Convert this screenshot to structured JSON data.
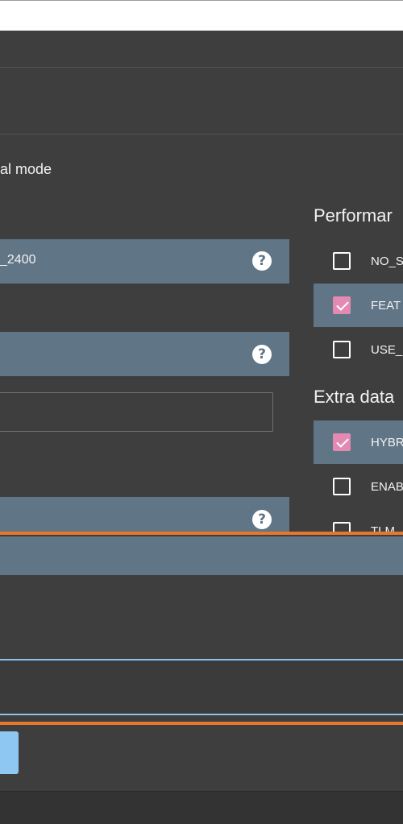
{
  "mode_text": "al mode",
  "fields": [
    {
      "value": "_2400",
      "help": "?"
    },
    {
      "value": "",
      "help": "?"
    },
    {
      "value": "",
      "help": "?"
    }
  ],
  "performance": {
    "title": "Performar",
    "items": [
      {
        "label": "NO_S",
        "checked": false
      },
      {
        "label": "FEAT",
        "checked": true
      },
      {
        "label": "USE_",
        "checked": false
      }
    ]
  },
  "extra_data": {
    "title": "Extra data",
    "items": [
      {
        "label": "HYBR",
        "checked": true
      },
      {
        "label": "ENAB",
        "checked": false
      },
      {
        "label": "TLM",
        "checked": false
      }
    ]
  },
  "colors": {
    "background": "#3e3e3e",
    "field": "#607586",
    "orange_border": "#e8772e",
    "check_accent": "#e389b2",
    "input_border": "#8ec1ea",
    "button": "#8ec8f2"
  }
}
